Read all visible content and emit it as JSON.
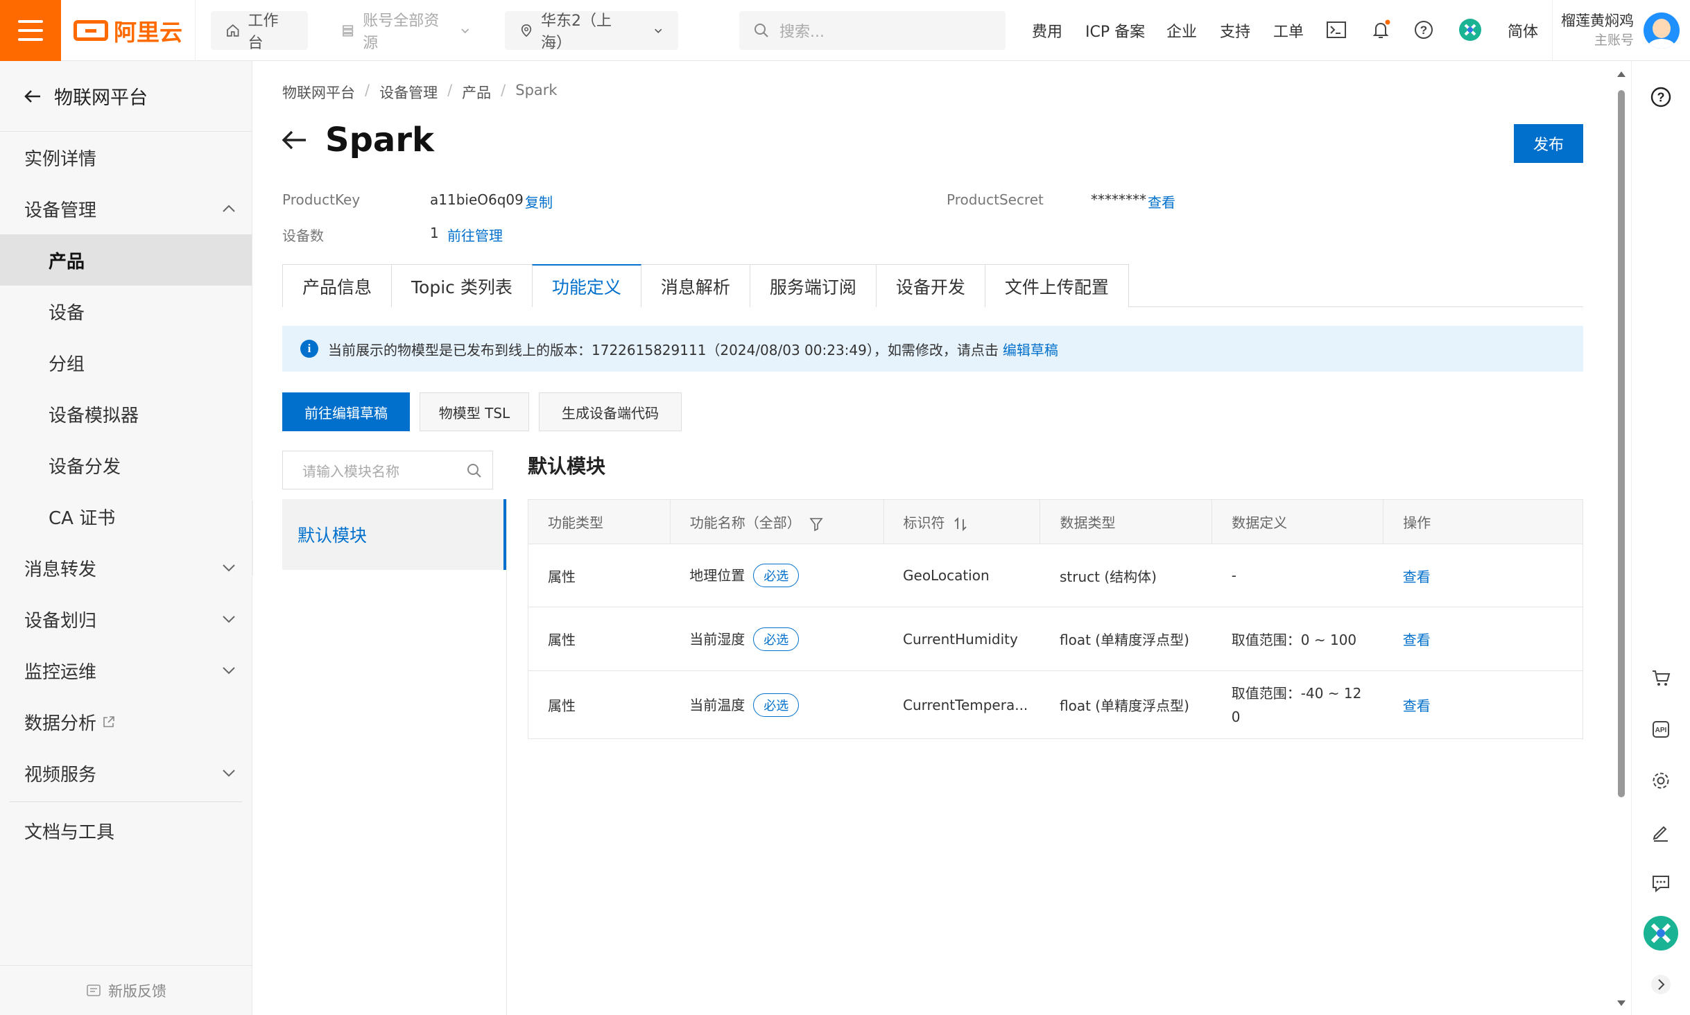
{
  "topbar": {
    "logo_text": "阿里云",
    "workbench": "工作台",
    "resources": "账号全部资源",
    "region": "华东2（上海）",
    "search_placeholder": "搜索...",
    "links": [
      "费用",
      "ICP 备案",
      "企业",
      "支持",
      "工单"
    ],
    "lang": "简体",
    "user_name": "榴莲黄焖鸡",
    "user_role": "主账号"
  },
  "sidebar": {
    "back_title": "物联网平台",
    "items": [
      {
        "label": "实例详情"
      },
      {
        "label": "设备管理"
      },
      {
        "label": "产品"
      },
      {
        "label": "设备"
      },
      {
        "label": "分组"
      },
      {
        "label": "设备模拟器"
      },
      {
        "label": "设备分发"
      },
      {
        "label": "CA 证书"
      },
      {
        "label": "消息转发"
      },
      {
        "label": "设备划归"
      },
      {
        "label": "监控运维"
      },
      {
        "label": "数据分析"
      },
      {
        "label": "视频服务"
      },
      {
        "label": "文档与工具"
      }
    ],
    "feedback": "新版反馈"
  },
  "breadcrumb": [
    "物联网平台",
    "设备管理",
    "产品",
    "Spark"
  ],
  "product": {
    "name": "Spark",
    "publish": "发布",
    "product_key_label": "ProductKey",
    "product_key": "a11bieO6q09",
    "copy": "复制",
    "device_count_label": "设备数",
    "device_count": "1",
    "manage": "前往管理",
    "secret_label": "ProductSecret",
    "secret": "********",
    "view": "查看"
  },
  "tabs": [
    "产品信息",
    "Topic 类列表",
    "功能定义",
    "消息解析",
    "服务端订阅",
    "设备开发",
    "文件上传配置"
  ],
  "notice": {
    "text": "当前展示的物模型是已发布到线上的版本：1722615829111（2024/08/03 00:23:49），如需修改，请点击",
    "link": "编辑草稿"
  },
  "actions": {
    "edit_draft": "前往编辑草稿",
    "tsl": "物模型 TSL",
    "gen_code": "生成设备端代码"
  },
  "modules": {
    "search_placeholder": "请输入模块名称",
    "items": [
      "默认模块"
    ],
    "title": "默认模块"
  },
  "table": {
    "headers": [
      "功能类型",
      "功能名称（全部）",
      "标识符",
      "数据类型",
      "数据定义",
      "操作"
    ],
    "required_tag": "必选",
    "rows": [
      {
        "type": "属性",
        "name": "地理位置",
        "id": "GeoLocation",
        "dtype": "struct (结构体)",
        "def": "-",
        "op": "查看"
      },
      {
        "type": "属性",
        "name": "当前湿度",
        "id": "CurrentHumidity",
        "dtype": "float (单精度浮点型)",
        "def": "取值范围：0 ~ 100",
        "op": "查看"
      },
      {
        "type": "属性",
        "name": "当前温度",
        "id": "CurrentTempera...",
        "dtype": "float (单精度浮点型)",
        "def": "取值范围：-40 ~ 120",
        "op": "查看"
      }
    ]
  },
  "colors": {
    "brand": "#ff6a00",
    "primary": "#0070cc"
  }
}
